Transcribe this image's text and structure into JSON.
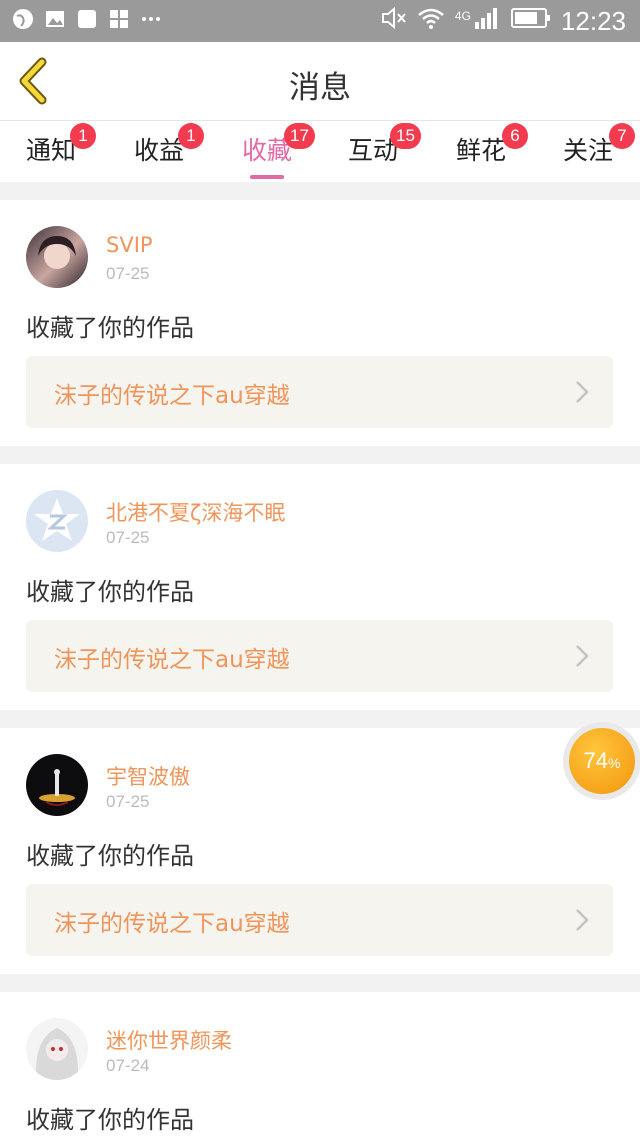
{
  "status_bar": {
    "time": "12:23",
    "network": "4G",
    "icons": [
      "globe-icon",
      "image-icon",
      "square-icon",
      "apps-icon",
      "more-icon"
    ]
  },
  "header": {
    "title": "消息",
    "back_icon": "chevron-left-icon"
  },
  "tabs": [
    {
      "label": "通知",
      "badge": "1"
    },
    {
      "label": "收益",
      "badge": "1"
    },
    {
      "label": "收藏",
      "badge": "17",
      "active": true
    },
    {
      "label": "互动",
      "badge": "15"
    },
    {
      "label": "鲜花",
      "badge": "6"
    },
    {
      "label": "关注",
      "badge": "7"
    }
  ],
  "items": [
    {
      "username": "SVIP",
      "date": "07-25",
      "action": "收藏了你的作品",
      "work_title": "沫子的传说之下au穿越"
    },
    {
      "username": "北港不夏ζ深海不眠",
      "date": "07-25",
      "action": "收藏了你的作品",
      "work_title": "沫子的传说之下au穿越"
    },
    {
      "username": "宇智波傲",
      "date": "07-25",
      "action": "收藏了你的作品",
      "work_title": "沫子的传说之下au穿越"
    },
    {
      "username": "迷你世界颜柔",
      "date": "07-24",
      "action": "收藏了你的作品"
    }
  ],
  "progress": {
    "value": "74",
    "unit": "%"
  },
  "colors": {
    "accent": "#e46aa6",
    "badge": "#f23b4f",
    "username": "#f0955a",
    "progress": "#f2960c"
  }
}
